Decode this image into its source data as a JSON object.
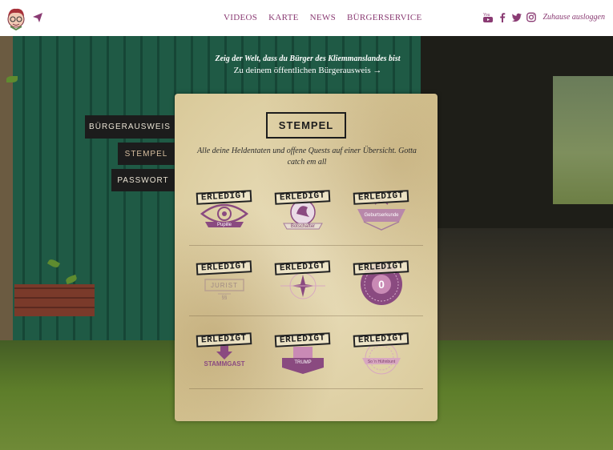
{
  "nav": {
    "items": [
      "VIDEOS",
      "KARTE",
      "NEWS",
      "BÜRGERSERVICE"
    ]
  },
  "header": {
    "logout_label": "Zuhause ausloggen",
    "social_icons": [
      "youtube-icon",
      "facebook-icon",
      "twitter-icon",
      "instagram-icon"
    ],
    "accent_color": "#8a3b73"
  },
  "promo": {
    "line1": "Zeig der Welt, dass du Bürger des Kliemmanslandes bist",
    "line2": "Zu deinem öffentlichen Bürgerausweis →"
  },
  "sidebar": {
    "items": [
      {
        "label": "BÜRGERAUSWEIS",
        "active": false
      },
      {
        "label": "STEMPEL",
        "active": true
      },
      {
        "label": "PASSWORT",
        "active": false
      }
    ]
  },
  "panel": {
    "title": "STEMPEL",
    "subtitle": "Alle deine Heldentaten und offene Quests auf einer Übersicht. Gotta catch em all",
    "stamp_label": "ERLEDIGT",
    "badges": [
      {
        "caption": "Pupille",
        "icon": "eye-icon"
      },
      {
        "caption": "Botschafter",
        "icon": "seal-icon"
      },
      {
        "caption": "Geburtserkunde",
        "icon": "ribbon-icon"
      },
      {
        "caption": "JURIST",
        "sub": "§§",
        "icon": "law-icon"
      },
      {
        "caption": "",
        "icon": "compass-icon"
      },
      {
        "caption": "0",
        "icon": "coin-icon"
      },
      {
        "caption": "STAMMGAST",
        "icon": "arrow-down-icon"
      },
      {
        "caption": "TRUMP",
        "icon": "hat-icon"
      },
      {
        "caption": "So 'n Hühnbunt",
        "icon": "ornament-icon"
      }
    ]
  }
}
